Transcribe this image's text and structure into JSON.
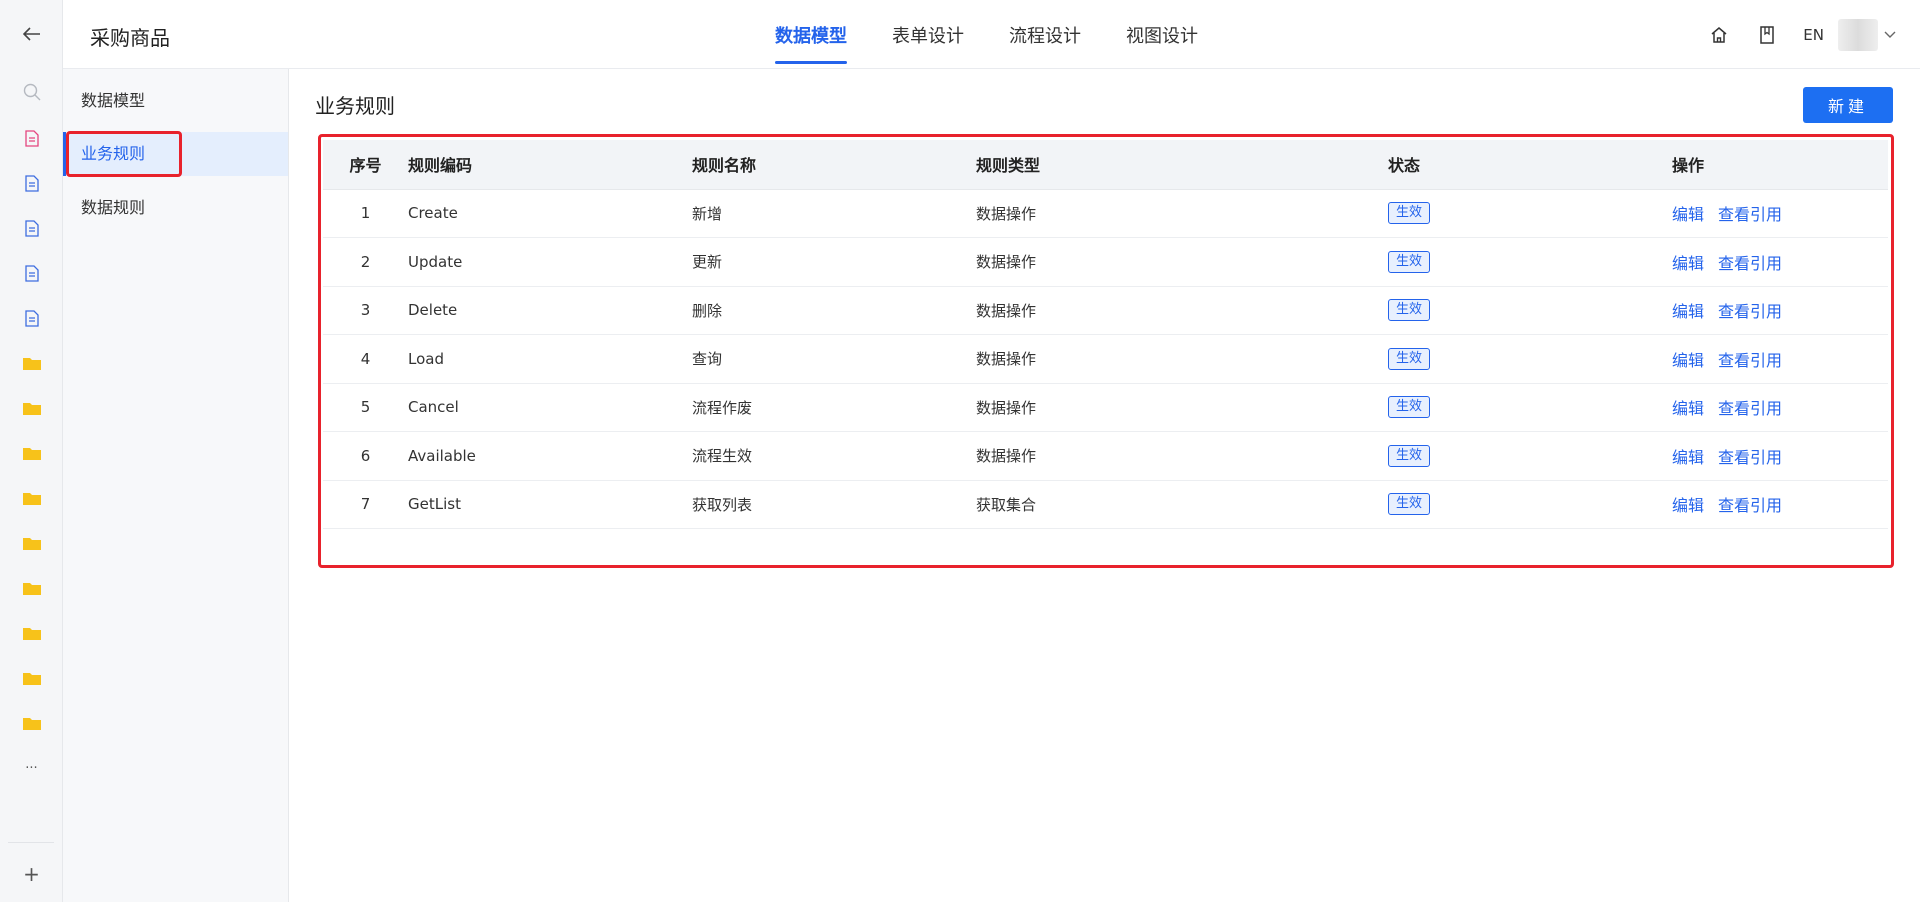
{
  "header": {
    "app_title": "采购商品",
    "tabs": [
      {
        "label": "数据模型",
        "active": true
      },
      {
        "label": "表单设计",
        "active": false
      },
      {
        "label": "流程设计",
        "active": false
      },
      {
        "label": "视图设计",
        "active": false
      }
    ],
    "lang": "EN"
  },
  "rail": {
    "icons": [
      "back-arrow-icon",
      "search-icon",
      "document-red-icon",
      "document-icon",
      "document-icon",
      "document-icon",
      "document-icon",
      "folder-icon",
      "folder-icon",
      "folder-icon",
      "folder-icon",
      "folder-icon",
      "folder-icon",
      "folder-icon",
      "folder-icon",
      "folder-icon"
    ],
    "more": "...",
    "add": "+"
  },
  "subnav": {
    "items": [
      {
        "label": "数据模型",
        "active": false
      },
      {
        "label": "业务规则",
        "active": true
      },
      {
        "label": "数据规则",
        "active": false
      }
    ]
  },
  "main": {
    "title": "业务规则",
    "new_button": "新建",
    "table": {
      "headers": [
        "序号",
        "规则编码",
        "规则名称",
        "规则类型",
        "状态",
        "操作"
      ],
      "rows": [
        {
          "seq": "1",
          "code": "Create",
          "name": "新增",
          "type": "数据操作",
          "status": "生效"
        },
        {
          "seq": "2",
          "code": "Update",
          "name": "更新",
          "type": "数据操作",
          "status": "生效"
        },
        {
          "seq": "3",
          "code": "Delete",
          "name": "删除",
          "type": "数据操作",
          "status": "生效"
        },
        {
          "seq": "4",
          "code": "Load",
          "name": "查询",
          "type": "数据操作",
          "status": "生效"
        },
        {
          "seq": "5",
          "code": "Cancel",
          "name": "流程作废",
          "type": "数据操作",
          "status": "生效"
        },
        {
          "seq": "6",
          "code": "Available",
          "name": "流程生效",
          "type": "数据操作",
          "status": "生效"
        },
        {
          "seq": "7",
          "code": "GetList",
          "name": "获取列表",
          "type": "获取集合",
          "status": "生效"
        }
      ],
      "actions": {
        "edit": "编辑",
        "view_ref": "查看引用"
      }
    }
  },
  "colors": {
    "accent": "#2463eb",
    "button": "#1d6ff2",
    "highlight": "#e8222c",
    "folder": "#f7c21a",
    "doc_red": "#e5457f",
    "doc_blue": "#3d6de0"
  }
}
